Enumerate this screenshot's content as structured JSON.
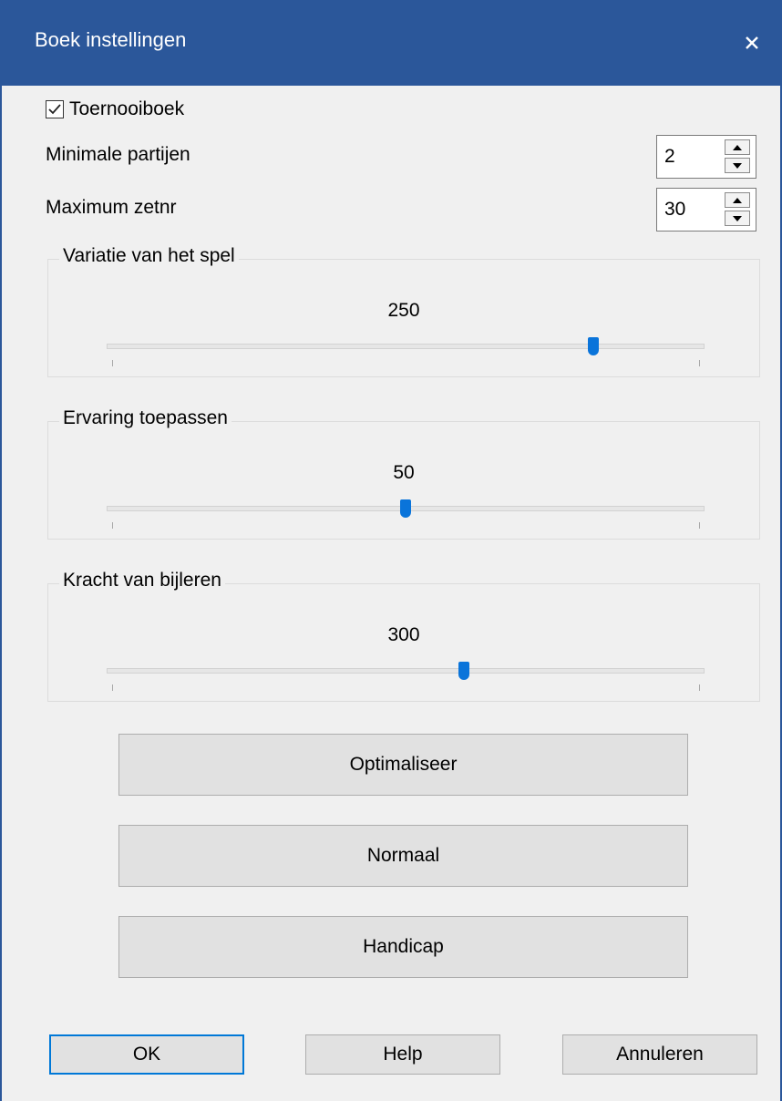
{
  "window": {
    "title": "Boek instellingen"
  },
  "toernooiboek": {
    "label": "Toernooiboek",
    "checked": true
  },
  "min_partijen": {
    "label": "Minimale partijen",
    "value": "2"
  },
  "max_zetnr": {
    "label": "Maximum zetnr",
    "value": "30"
  },
  "groups": [
    {
      "title": "Variatie van het spel",
      "value": "250",
      "position_fraction": 0.815
    },
    {
      "title": "Ervaring toepassen",
      "value": "50",
      "position_fraction": 0.5
    },
    {
      "title": "Kracht van bijleren",
      "value": "300",
      "position_fraction": 0.598
    }
  ],
  "buttons": {
    "optimaliseer": "Optimaliseer",
    "normaal": "Normaal",
    "handicap": "Handicap",
    "ok": "OK",
    "help": "Help",
    "annuleren": "Annuleren"
  },
  "colors": {
    "titlebar": "#2b579a",
    "slider_thumb": "#0a74da",
    "default_button_border": "#0078d7"
  }
}
